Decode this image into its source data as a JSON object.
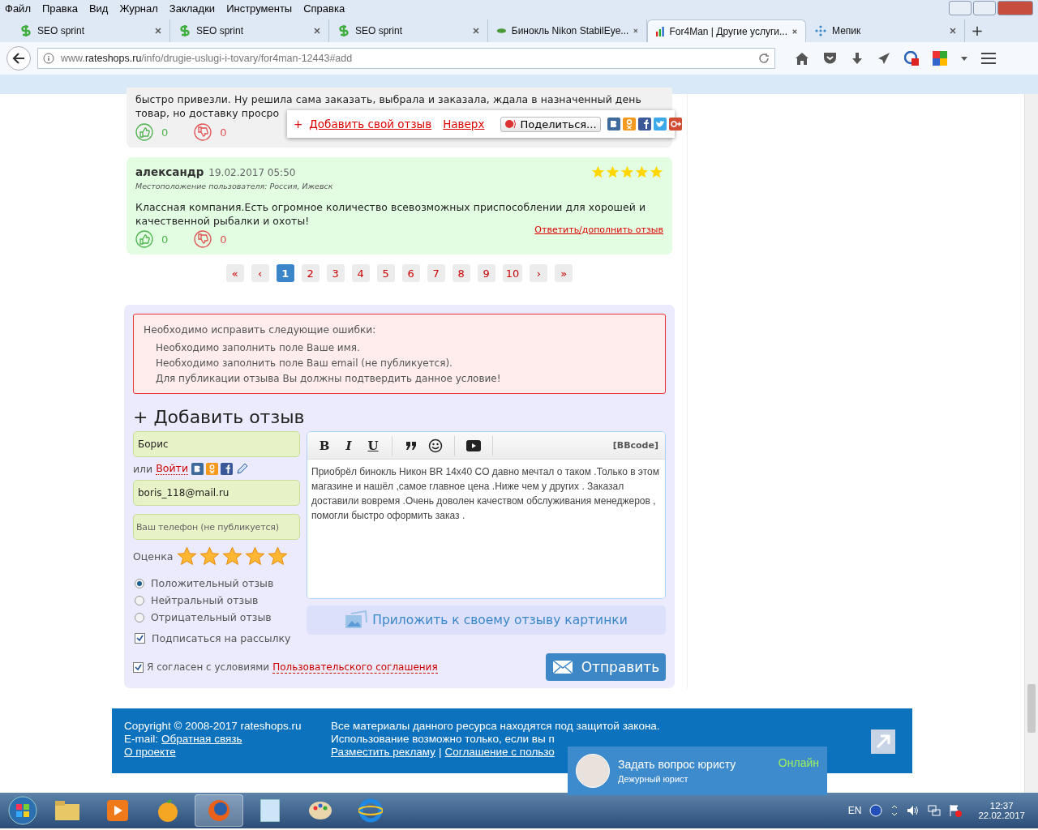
{
  "menu": [
    "Файл",
    "Правка",
    "Вид",
    "Журнал",
    "Закладки",
    "Инструменты",
    "Справка"
  ],
  "tabs": [
    {
      "title": "SEO sprint",
      "selected": false,
      "kind": "seo"
    },
    {
      "title": "SEO sprint",
      "selected": false,
      "kind": "seo"
    },
    {
      "title": "SEO sprint",
      "selected": false,
      "kind": "seo"
    },
    {
      "title": "Бинокль Nikon StabilEye...",
      "selected": false,
      "kind": "leaf"
    },
    {
      "title": "For4Man | Другие услуги...",
      "selected": true,
      "kind": "bars"
    },
    {
      "title": "Мепик",
      "selected": false,
      "kind": "dots"
    }
  ],
  "new_tab": "+",
  "address": {
    "url": "www.**rateshops.ru**/info/drugie-uslugi-i-tovary/for4man-12443#add"
  },
  "partial_review": {
    "lines": [
      "быстро привезли. Ну решила сама заказать, выбрала и заказала, ждала в назначенный день",
      "товар, но доставку просро"
    ],
    "likes": "0",
    "dislikes": "0"
  },
  "share_bar": {
    "plus": "+",
    "add_link": "Добавить свой отзыв",
    "top_link": "Наверх",
    "share_button": "Поделиться..."
  },
  "review": {
    "author": "александр",
    "date": "19.02.2017 05:50",
    "location": "Местоположение пользователя: Россия, Ижевск",
    "stars": 5,
    "text": "Классная компания.Есть огромное количество всевозможных приспособлении для хорошей и качественной рыбалки и охоты!",
    "reply_link": "Ответить/дополнить отзыв",
    "likes": "0",
    "dislikes": "0"
  },
  "pagination": [
    {
      "label": "«",
      "selected": false
    },
    {
      "label": "‹",
      "selected": false
    },
    {
      "label": "1",
      "selected": true
    },
    {
      "label": "2",
      "selected": false
    },
    {
      "label": "3",
      "selected": false
    },
    {
      "label": "4",
      "selected": false
    },
    {
      "label": "5",
      "selected": false
    },
    {
      "label": "6",
      "selected": false
    },
    {
      "label": "7",
      "selected": false
    },
    {
      "label": "8",
      "selected": false
    },
    {
      "label": "9",
      "selected": false
    },
    {
      "label": "10",
      "selected": false
    },
    {
      "label": "›",
      "selected": false
    },
    {
      "label": "»",
      "selected": false
    }
  ],
  "form": {
    "errors": {
      "title": "Необходимо исправить следующие ошибки:",
      "items": [
        "Необходимо заполнить поле Ваше имя.",
        "Необходимо заполнить поле Ваш email (не публикуется).",
        "Для публикации отзыва Вы должны подтвердить данное условие!"
      ]
    },
    "heading": "+ Добавить отзыв",
    "name_value": "Борис",
    "or_label": "или",
    "login_link": "Войти",
    "email_value": "boris_118@mail.ru",
    "phone_placeholder": "Ваш телефон (не публикуется)",
    "rating_label": "Оценка",
    "stars": 5,
    "sentiments": [
      {
        "label": "Положительный отзыв",
        "selected": true
      },
      {
        "label": "Нейтральный отзыв",
        "selected": false
      },
      {
        "label": "Отрицательный отзыв",
        "selected": false
      }
    ],
    "subscribe": {
      "label": "Подписаться на рассылку",
      "checked": true
    },
    "toolbar": [
      {
        "kind": "bold",
        "label": "B"
      },
      {
        "kind": "italic",
        "label": "I"
      },
      {
        "kind": "underline",
        "label": "U"
      },
      {
        "kind": "quote"
      },
      {
        "kind": "smile"
      },
      {
        "kind": "video"
      }
    ],
    "bbcode": "[BBcode]",
    "text": "Приобрёл бинокль Никон BR 14x40 CO давно мечтал о таком .Только в этом магазине и нашёл ,самое главное цена .Ниже чем у других . Заказал доставили вовремя .Очень доволен качеством обслуживания менеджеров , помогли быстро оформить заказ .",
    "attach_button": "Приложить к своему отзыву картинки",
    "agree": {
      "label": "Я согласен с условиями",
      "link": "Пользовательского соглашения",
      "checked": true
    },
    "send_button": "Отправить"
  },
  "footer": {
    "copyright": "Copyright © 2008-2017 rateshops.ru",
    "email_label": "E-mail:",
    "feedback_link": "Обратная связь",
    "about_link": "О проекте",
    "notice": "Все материалы данного ресурса находятся под защитой закона.",
    "notice_cut": "Использование возможно только, если вы п",
    "ads_link": "Разместить рекламу",
    "separator": "|",
    "agreement_link": "Соглашение с пользо"
  },
  "chat": {
    "title": "Задать вопрос юристу",
    "status": "Онлайн",
    "subtitle": "Дежурный юрист"
  },
  "taskbar": {
    "lang": "EN",
    "time": "12:37",
    "date": "22.02.2017"
  }
}
